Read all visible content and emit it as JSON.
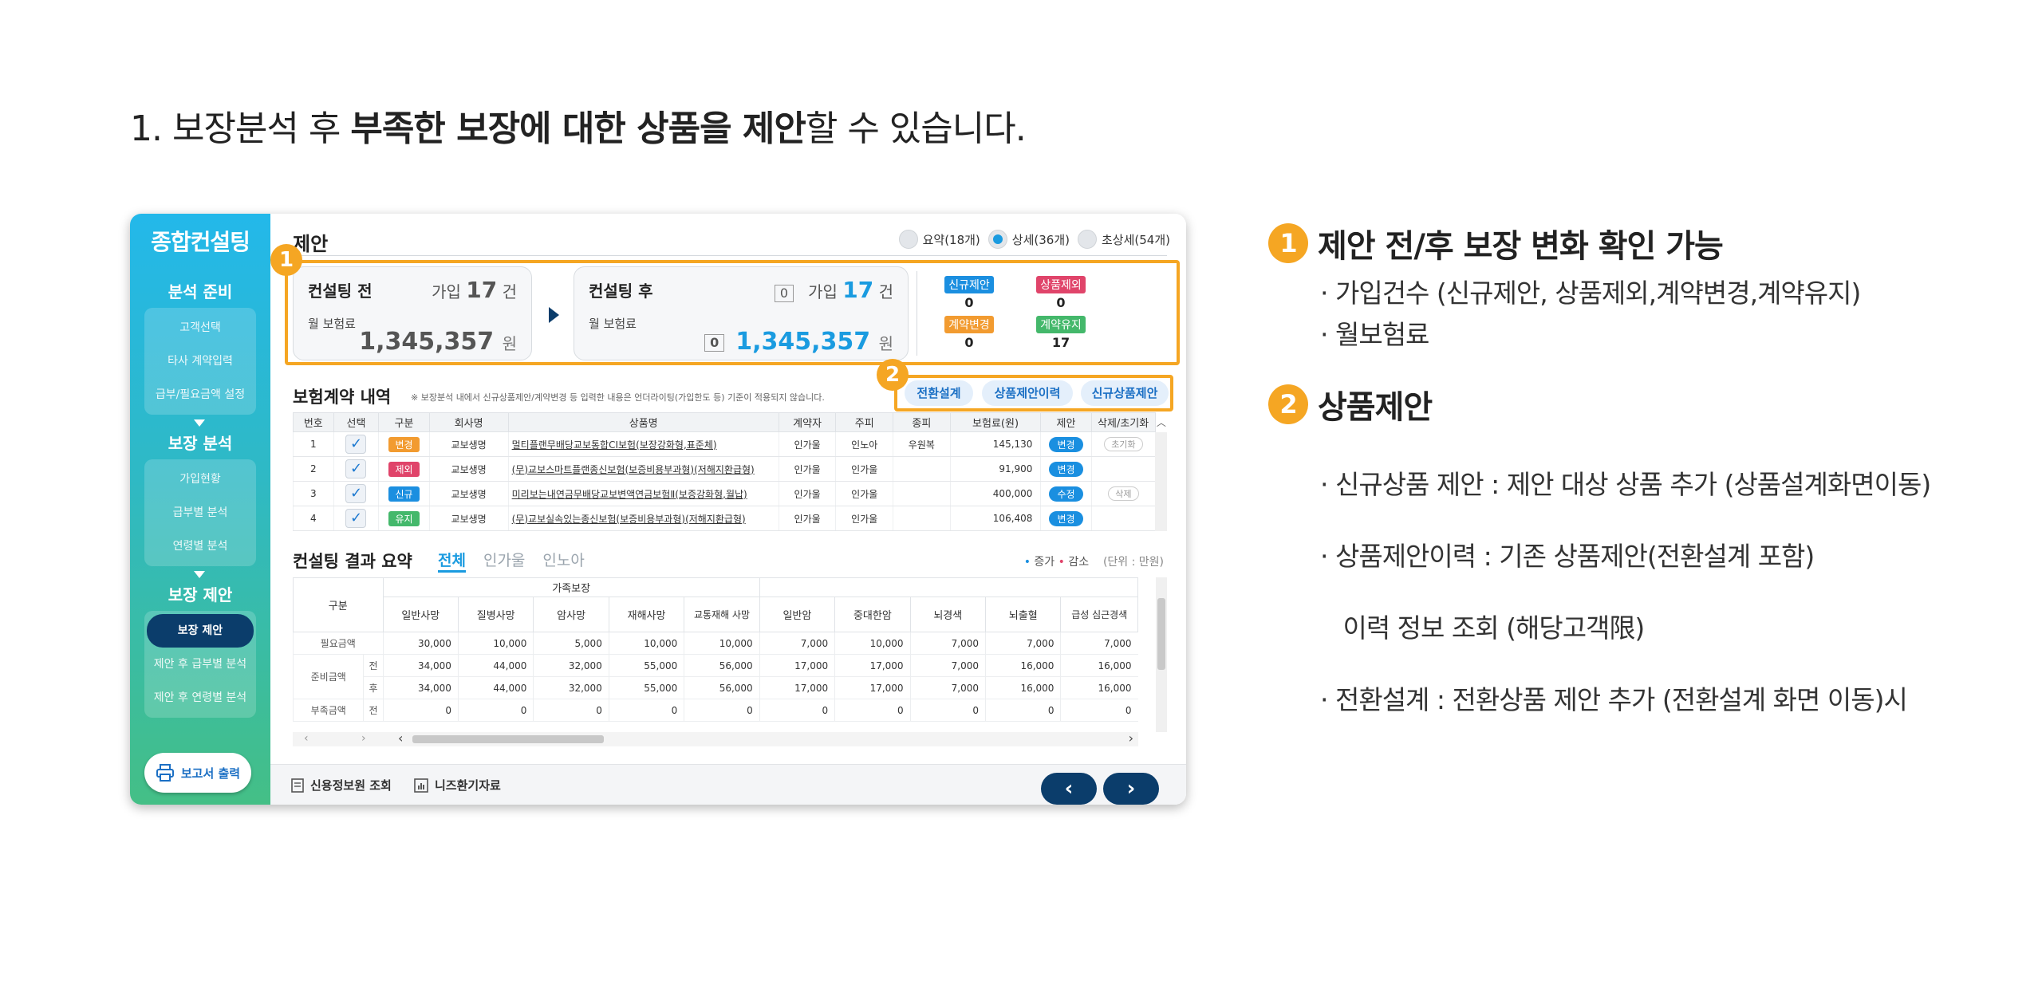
{
  "heading": {
    "prefix": "1. 보장분석 후 ",
    "bold": "부족한 보장에 대한 상품을 제안",
    "suffix": "할 수 있습니다."
  },
  "sidebar": {
    "title": "종합컨설팅",
    "sections": [
      {
        "label": "분석 준비",
        "items": [
          "고객선택",
          "타사 계약입력",
          "급부/필요금액 설정"
        ]
      },
      {
        "label": "보장 분석",
        "items": [
          "가입현황",
          "급부별 분석",
          "연령별 분석"
        ]
      },
      {
        "label": "보장 제안",
        "items": [
          "보장 제안",
          "제안 후 급부별 분석",
          "제안 후 연령별 분석"
        ]
      }
    ],
    "print_label": "보고서 출력"
  },
  "main": {
    "title": "제안",
    "view_options": [
      {
        "label": "요약(18개)",
        "selected": false
      },
      {
        "label": "상세(36개)",
        "selected": true
      },
      {
        "label": "초상세(54개)",
        "selected": false
      }
    ],
    "before": {
      "label": "컨설팅 전",
      "count_prefix": "가입",
      "count": "17",
      "count_unit": "건",
      "premium_label": "월 보험료",
      "premium": "1,345,357",
      "unit": "원"
    },
    "after": {
      "label": "컨설팅 후",
      "count_box": "0",
      "count_prefix": "가입",
      "count": "17",
      "count_unit": "건",
      "premium_label": "월 보험료",
      "premium_box": "0",
      "premium": "1,345,357",
      "unit": "원"
    },
    "status": [
      {
        "label": "신규제안",
        "value": "0",
        "color": "#1b8fe0"
      },
      {
        "label": "상품제외",
        "value": "0",
        "color": "#e0446a"
      },
      {
        "label": "계약변경",
        "value": "0",
        "color": "#f29b30"
      },
      {
        "label": "계약유지",
        "value": "17",
        "color": "#44b86b"
      }
    ],
    "contract_title": "보험계약 내역",
    "contract_note": "※ 보장분석 내에서 신규상품제안/계약변경 등 입력한 내용은 언더라이팅(가입한도 등) 기준이 적용되지 않습니다.",
    "actions": [
      "전환설계",
      "상품제안이력",
      "신규상품제안"
    ],
    "contract_headers": [
      "번호",
      "선택",
      "구분",
      "회사명",
      "상품명",
      "계약자",
      "주피",
      "종피",
      "보험료(원)",
      "제안",
      "삭제/초기화"
    ],
    "contract_rows": [
      {
        "no": "1",
        "type": "변경",
        "type_color": "#f29b30",
        "company": "교보생명",
        "product": "멀티플랜무배당교보통합CI보험(보장강화형,표준체)",
        "holder": "인가울",
        "insured": "인노아",
        "sub": "우원복",
        "premium": "145,130",
        "action": "변경",
        "extra": "초기화"
      },
      {
        "no": "2",
        "type": "제외",
        "type_color": "#e0446a",
        "company": "교보생명",
        "product": "(무)교보스마트플랜종신보험(보증비용부과형)(저해지환급형)",
        "holder": "인가울",
        "insured": "인가울",
        "sub": "",
        "premium": "91,900",
        "action": "변경",
        "extra": ""
      },
      {
        "no": "3",
        "type": "신규",
        "type_color": "#1b8fe0",
        "company": "교보생명",
        "product": "미리보는내연금무배당교보변액연금보험Ⅱ(보증강화형,월납)",
        "holder": "인가울",
        "insured": "인가울",
        "sub": "",
        "premium": "400,000",
        "action": "수정",
        "extra": "삭제"
      },
      {
        "no": "4",
        "type": "유지",
        "type_color": "#44b86b",
        "company": "교보생명",
        "product": "(무)교보실속있는종신보험(보증비용부과형)(저해지환급형)",
        "holder": "인가울",
        "insured": "인가울",
        "sub": "",
        "premium": "106,408",
        "action": "변경",
        "extra": ""
      }
    ],
    "summary_title": "컨설팅 결과 요약",
    "summary_tabs": [
      "전체",
      "인가울",
      "인노아"
    ],
    "legend": {
      "up": "증가",
      "down": "감소",
      "unit": "(단위 : 만원)"
    },
    "summary_group": "가족보장",
    "summary_first_col": "구분",
    "summary_headers": [
      "일반사망",
      "질병사망",
      "암사망",
      "재해사망",
      "교통재해 사망",
      "일반암",
      "중대한암",
      "뇌경색",
      "뇌출혈",
      "급성 심근경색"
    ],
    "summary_rows": [
      {
        "label": "필요금액",
        "sub": "",
        "values": [
          "30,000",
          "10,000",
          "5,000",
          "10,000",
          "10,000",
          "7,000",
          "10,000",
          "7,000",
          "7,000",
          "7,000"
        ]
      },
      {
        "label": "준비금액",
        "sub": "전",
        "values": [
          "34,000",
          "44,000",
          "32,000",
          "55,000",
          "56,000",
          "17,000",
          "17,000",
          "7,000",
          "16,000",
          "16,000"
        ]
      },
      {
        "label": "",
        "sub": "후",
        "values": [
          "34,000",
          "44,000",
          "32,000",
          "55,000",
          "56,000",
          "17,000",
          "17,000",
          "7,000",
          "16,000",
          "16,000"
        ]
      },
      {
        "label": "부족금액",
        "sub": "전",
        "values": [
          "0",
          "0",
          "0",
          "0",
          "0",
          "0",
          "0",
          "0",
          "0",
          "0"
        ]
      }
    ],
    "footer": {
      "credit": "신용정보원 조회",
      "needs": "니즈환기자료"
    }
  },
  "callouts": {
    "one": "1",
    "two": "2"
  },
  "description": {
    "items": [
      {
        "num": "1",
        "title": "제안 전/후 보장 변화 확인 가능",
        "lines": [
          "· 가입건수 (신규제안, 상품제외,계약변경,계약유지)",
          "· 월보험료"
        ]
      },
      {
        "num": "2",
        "title": "상품제안",
        "lines": [
          "· 신규상품 제안 : 제안 대상 상품 추가 (상품설계화면이동)",
          "· 상품제안이력 : 기존 상품제안(전환설계 포함)",
          "   이력 정보 조회 (해당고객限)",
          "· 전환설계 : 전환상품 제안 추가 (전환설계 화면 이동)시"
        ]
      }
    ]
  }
}
